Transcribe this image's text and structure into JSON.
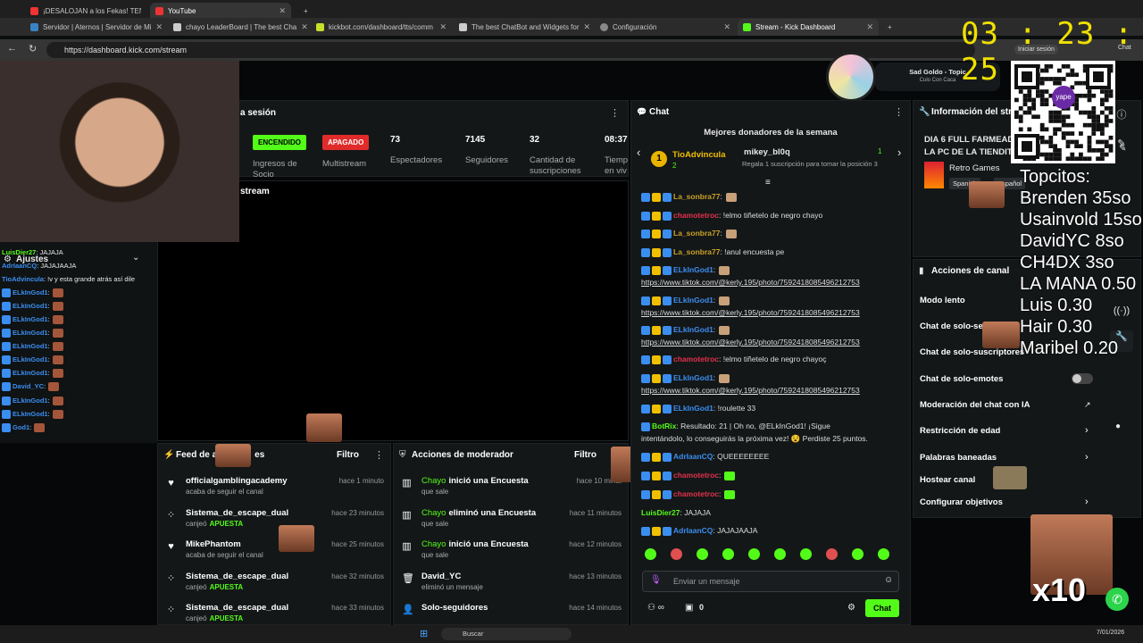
{
  "browser": {
    "tabs_row1": [
      "¡DESALOJAN a los Fekas! TEN",
      "YouTube"
    ],
    "tabs_row2": [
      "Servidor | Aternos | Servidor de Mi",
      "chayo LeaderBoard | The best Cha",
      "kickbot.com/dashboard/tts/comm",
      "The best ChatBot and Widgets for",
      "Configuración",
      "Stream - Kick Dashboard"
    ],
    "url": "https://dashboard.kick.com/stream",
    "signin": "Iniciar sesión",
    "chat_label": "Chat"
  },
  "timer": {
    "h": "03",
    "sep": ":",
    "m": "23",
    "s": "25"
  },
  "music": {
    "title": "Sad Goldo - Topic",
    "subtitle": "Culo Con Caca"
  },
  "session": {
    "title_partial": "a sesión",
    "status_on": "ENCENDIDO",
    "status_off": "APAGADO",
    "label_ingresos": "Ingresos de",
    "label_socio": "Socio",
    "label_multistream": "Multistream",
    "viewers": "73",
    "viewers_label": "Espectadores",
    "followers": "7145",
    "followers_label": "Seguidores",
    "subs": "32",
    "subs_label1": "Cantidad de",
    "subs_label2": "suscripciones",
    "time": "08:37",
    "time_label1": "Tiemp",
    "time_label2": "en viv"
  },
  "stream_panel": {
    "title_partial": "stream",
    "ajustes": "Ajustes"
  },
  "chat": {
    "title": "Chat",
    "donors_title": "Mejores donadores de la semana",
    "donor1_name": "TioAdvincula",
    "donor1_rank": "1",
    "donor1_count": "2",
    "donor2_name": "mikey_bl0q",
    "donor2_count": "1",
    "donor2_sub": "Regala 1 suscripción para tomar la posición 3",
    "messages": [
      {
        "user": "La_sonbra77",
        "text": ":",
        "color": "#c9a227"
      },
      {
        "user": "chamotetroc",
        "text": ": !elmo tiñetelo de negro chayo",
        "color": "#e0324b"
      },
      {
        "user": "La_sonbra77",
        "text": ":",
        "color": "#c9a227"
      },
      {
        "user": "La_sonbra77",
        "text": ": !anul encuesta pe",
        "color": "#c9a227"
      },
      {
        "user": "ELkInGod1",
        "text": ":",
        "color": "#3a8ef0"
      },
      {
        "user": "",
        "text": "https://www.tiktok.com/@kerly.195/photo/7592418085496212753",
        "color": ""
      },
      {
        "user": "ELkInGod1",
        "text": ":",
        "color": "#3a8ef0"
      },
      {
        "user": "",
        "text": "https://www.tiktok.com/@kerly.195/photo/7592418085496212753",
        "color": ""
      },
      {
        "user": "ELkInGod1",
        "text": ":",
        "color": "#3a8ef0"
      },
      {
        "user": "",
        "text": "https://www.tiktok.com/@kerly.195/photo/7592418085496212753",
        "color": ""
      },
      {
        "user": "chamotetroc",
        "text": ": !elmo tiñetelo de negro chayoç",
        "color": "#e0324b"
      },
      {
        "user": "ELkInGod1",
        "text": ":",
        "color": "#3a8ef0"
      },
      {
        "user": "",
        "text": "https://www.tiktok.com/@kerly.195/photo/7592418085496212753",
        "color": ""
      },
      {
        "user": "ELkInGod1",
        "text": ": !roulette 33",
        "color": "#3a8ef0"
      },
      {
        "user": "BotRix",
        "text": ": Resultado: 21 | Oh no, @ELkInGod1! ¡Sigue",
        "color": "#53fc18"
      },
      {
        "user": "",
        "text": "intentándolo, lo conseguirás la próxima vez! 😵 Perdiste 25 puntos.",
        "color": ""
      },
      {
        "user": "AdrIaanCQ",
        "text": ": QUEEEEEEEE",
        "color": "#3a8ef0"
      },
      {
        "user": "chamotetroc",
        "text": ":",
        "color": "#e0324b"
      },
      {
        "user": "chamotetroc",
        "text": ":",
        "color": "#e0324b"
      },
      {
        "user": "LuisDier27",
        "text": ": JAJAJA",
        "color": "#53fc18"
      },
      {
        "user": "AdrIaanCQ",
        "text": ": JAJAJAAJA",
        "color": "#3a8ef0"
      }
    ],
    "input_placeholder": "Enviar un mensaje",
    "points": "0",
    "send_label": "Chat"
  },
  "left_chat": [
    {
      "user": "LuisDier27",
      "text": ": JAJAJA",
      "color": "#53fc18"
    },
    {
      "user": "AdrIaanCQ",
      "text": ": JAJAJAAJA",
      "color": "#3a8ef0"
    },
    {
      "user": "TioAdvincula",
      "text": ": !v y esta grande atrás así dile",
      "color": "#3a8ef0"
    },
    {
      "user": "ELkInGod1",
      "text": ":",
      "color": "#3a8ef0"
    },
    {
      "user": "ELkInGod1",
      "text": ":",
      "color": "#3a8ef0"
    },
    {
      "user": "ELkInGod1",
      "text": ":",
      "color": "#3a8ef0"
    },
    {
      "user": "ELkInGod1",
      "text": ":",
      "color": "#3a8ef0"
    },
    {
      "user": "ELkInGod1",
      "text": ":",
      "color": "#3a8ef0"
    },
    {
      "user": "ELkInGod1",
      "text": ":",
      "color": "#3a8ef0"
    },
    {
      "user": "ELkInGod1",
      "text": ":",
      "color": "#3a8ef0"
    },
    {
      "user": "David_YC",
      "text": ":",
      "color": "#3a8ef0"
    },
    {
      "user": "ELkInGod1",
      "text": ":",
      "color": "#3a8ef0"
    },
    {
      "user": "ELkInGod1",
      "text": ":",
      "color": "#3a8ef0"
    },
    {
      "user": "God1",
      "text": ":",
      "color": "#3a8ef0"
    }
  ],
  "feed": {
    "title": "Feed de a",
    "title_suffix": "es",
    "filter": "Filtro",
    "items": [
      {
        "title": "officialgamblingacademy",
        "sub": "acaba de seguir el canal",
        "time": "hace 1 minuto",
        "icon": "heart-icon"
      },
      {
        "title": "Sistema_de_escape_dual",
        "sub": "canjeó",
        "sub_green": "APUESTA",
        "time": "hace 23 minutos",
        "icon": "dots-icon"
      },
      {
        "title": "MikePhantom",
        "sub": "acaba de seguir el canal",
        "time": "hace 25 minutos",
        "icon": "heart-icon"
      },
      {
        "title": "Sistema_de_escape_dual",
        "sub": "canjeó",
        "sub_green": "APUESTA",
        "time": "hace 32 minutos",
        "icon": "dots-icon"
      },
      {
        "title": "Sistema_de_escape_dual",
        "sub": "canjeó",
        "sub_green": "APUESTA",
        "time": "hace 33 minutos",
        "icon": "dots-icon"
      }
    ]
  },
  "modactions": {
    "title": "Acciones de moderador",
    "filter": "Filtro",
    "items": [
      {
        "user": "Chayo",
        "action": "inició una Encuesta",
        "sub": "que sale",
        "time": "hace 10 minut",
        "icon": "chart-icon"
      },
      {
        "user": "Chayo",
        "action": "eliminó una Encuesta",
        "sub": "que sale",
        "time": "hace 11 minutos",
        "icon": "chart-icon"
      },
      {
        "user": "Chayo",
        "action": "inició una Encuesta",
        "sub": "que sale",
        "time": "hace 12 minutos",
        "icon": "chart-icon"
      },
      {
        "user": "",
        "action": "David_YC",
        "sub": "eliminó un mensaje",
        "time": "hace 13 minutos",
        "icon": "trash-icon"
      },
      {
        "user": "",
        "action": "Solo-seguidores",
        "sub": "",
        "time": "hace 14 minutos",
        "icon": "user-icon"
      }
    ]
  },
  "info": {
    "title": "Información del str",
    "stream_title1": "DIA 6 FULL FARMEAD",
    "stream_title2": "LA PC DE LA TIENDITA",
    "category": "Retro Games",
    "tag1": "Spanish",
    "tag2": "Español"
  },
  "channel_actions": {
    "title": "Acciones de canal",
    "items": [
      "Modo lento",
      "Chat de solo-seg",
      "Chat de solo-suscriptores",
      "Chat de solo-emotes",
      "Moderación del chat con IA",
      "Restricción de edad",
      "Palabras baneadas",
      "Hostear canal",
      "Configurar objetivos"
    ]
  },
  "topcitos": {
    "title": "Topcitos:",
    "lines": [
      "Brenden 35so",
      "Usainvold 15so",
      "DavidYC 8so",
      "CH4DX 3so",
      "LA MANA 0.50",
      "Luis 0.30",
      "Hair 0.30",
      "Maribel 0.20"
    ]
  },
  "overlay_x10": "x10",
  "qr_label": "yape",
  "taskbar": {
    "search": "Buscar",
    "date": "7/01/2026"
  }
}
